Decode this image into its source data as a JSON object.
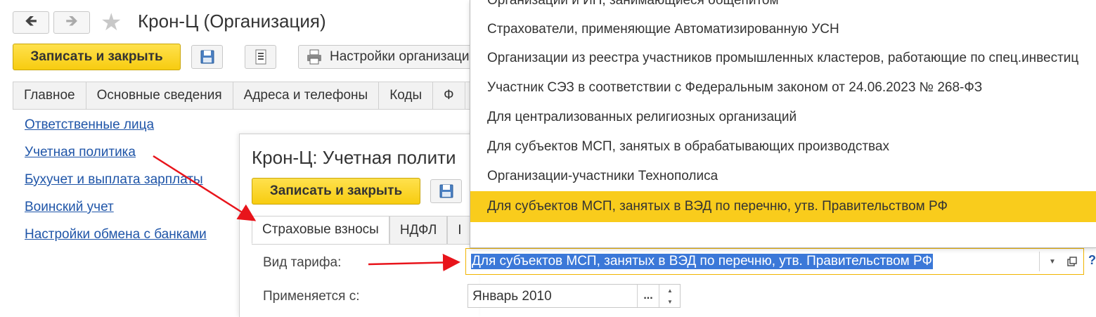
{
  "main_window": {
    "title": "Крон-Ц (Организация)",
    "back_icon": "arrow-left-icon",
    "forward_icon": "arrow-right-icon",
    "favorite_icon": "star-icon",
    "save_close_label": "Записать и закрыть",
    "settings_label": "Настройки организации",
    "tabs": [
      "Главное",
      "Основные сведения",
      "Адреса и телефоны",
      "Коды",
      "Ф"
    ],
    "links": [
      "Ответственные лица",
      "Учетная политика",
      "Бухучет и выплата зарплаты",
      "Воинский учет",
      "Настройки обмена с банками"
    ]
  },
  "policy_window": {
    "title": "Крон-Ц: Учетная полити",
    "save_close_label": "Записать и закрыть",
    "tabs": [
      "Страховые взносы",
      "НДФЛ",
      "I"
    ],
    "tariff_label": "Вид тарифа:",
    "applies_from_label": "Применяется с:",
    "tariff_value": "Для субъектов МСП, занятых в ВЭД по перечню, утв. Правительством РФ",
    "applies_from_value": "Январь 2010",
    "select_button_label": "...",
    "help_label": "?"
  },
  "dropdown": {
    "items": [
      "Организации и ИП, занимающиеся общепитом",
      "Страхователи, применяющие Автоматизированную УСН",
      "Организации из реестра участников промышленных кластеров, работающие по спец.инвестиц",
      "Участник СЭЗ в соответствии с Федеральным законом от 24.06.2023 № 268-ФЗ",
      "Для централизованных религиозных организаций",
      "Для субъектов МСП, занятых в обрабатывающих производствах",
      "Организации-участники Технополиса",
      "Для субъектов МСП, занятых в ВЭД по перечню, утв. Правительством РФ"
    ],
    "selected_index": 7
  },
  "colors": {
    "accent_yellow": "#f9cc1c",
    "link_blue": "#1f55a8",
    "arrow_red": "#e8141b",
    "selection_blue": "#3b78d8"
  }
}
